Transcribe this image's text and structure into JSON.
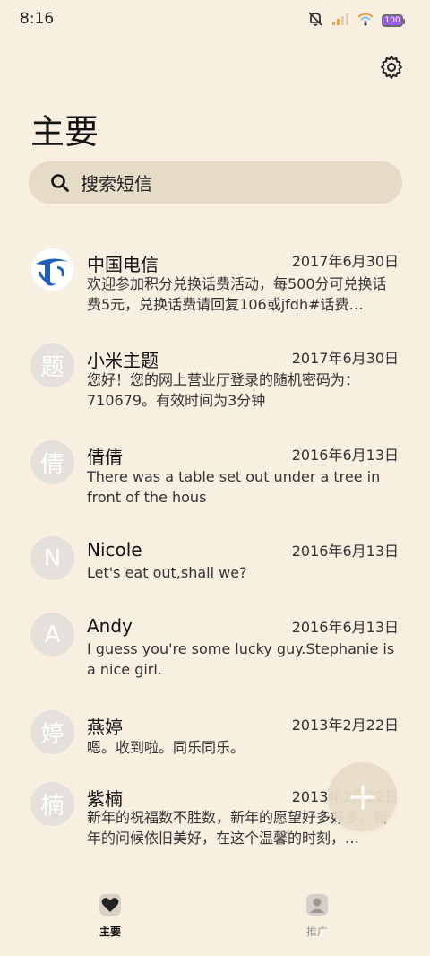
{
  "status": {
    "time": "8:16",
    "battery": "100",
    "icons": [
      "mute-icon",
      "signal-icon",
      "wifi-icon",
      "battery-icon"
    ]
  },
  "header": {
    "title": "主要",
    "settings_icon": "gear-icon"
  },
  "search": {
    "placeholder": "搜索短信",
    "icon": "search-icon"
  },
  "messages": [
    {
      "sender": "中国电信",
      "date": "2017年6月30日",
      "preview": "欢迎参加积分兑换话费活动，每500分可兑换话费5元，兑换话费请回复106或jfdh#话费…",
      "avatar": ""
    },
    {
      "sender": "小米主题",
      "date": "2017年6月30日",
      "preview": "您好！您的网上营业厅登录的随机密码为：710679。有效时间为3分钟",
      "avatar": "题"
    },
    {
      "sender": "倩倩",
      "date": "2016年6月13日",
      "preview": "There was a table set out under a tree in front of the hous",
      "avatar": "倩"
    },
    {
      "sender": "Nicole",
      "date": "2016年6月13日",
      "preview": "Let's eat out,shall we?",
      "avatar": "N"
    },
    {
      "sender": "Andy",
      "date": "2016年6月13日",
      "preview": "I guess you're some lucky guy.Stephanie is a nice girl.",
      "avatar": "A"
    },
    {
      "sender": "燕婷",
      "date": "2013年2月22日",
      "preview": "嗯。收到啦。同乐同乐。",
      "avatar": "婷"
    },
    {
      "sender": "紫楠",
      "date": "2013年2月22日",
      "preview": "新年的祝福数不胜数，新年的愿望好多好多，新年的问候依旧美好，在这个温馨的时刻，…",
      "avatar": "楠"
    }
  ],
  "fab": {
    "icon": "plus-icon"
  },
  "nav": {
    "items": [
      {
        "label": "主要",
        "icon": "heart-icon",
        "active": true
      },
      {
        "label": "推广",
        "icon": "person-icon",
        "active": false
      }
    ]
  },
  "colors": {
    "background": "#f9efe1",
    "search_bg": "#e5dbc6",
    "avatar_bg": "#e4e0dc",
    "brand_blue": "#1d5fb8"
  }
}
